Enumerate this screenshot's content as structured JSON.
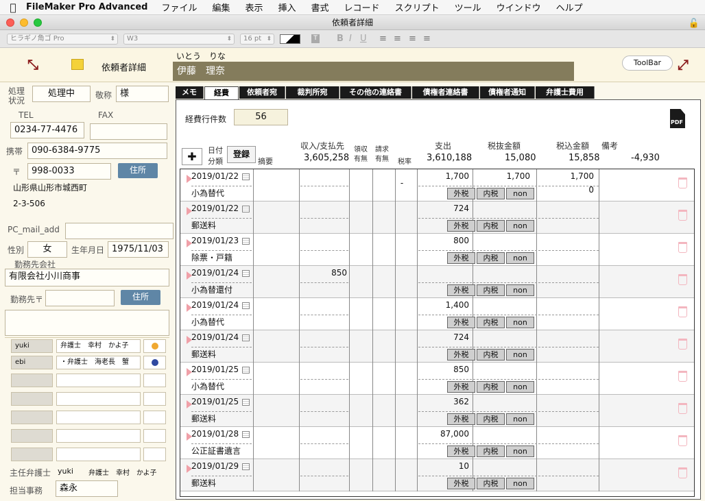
{
  "menubar": {
    "app_name": "FileMaker Pro Advanced",
    "items": [
      "ファイル",
      "編集",
      "表示",
      "挿入",
      "書式",
      "レコード",
      "スクリプト",
      "ツール",
      "ウインドウ",
      "ヘルプ"
    ]
  },
  "window": {
    "title": "依頼者詳細"
  },
  "format_bar": {
    "font": "ヒラギノ角ゴ Pro",
    "weight": "W3",
    "size": "16 pt"
  },
  "header": {
    "layout_title": "依頼者詳細",
    "furigana": "いとう　りな",
    "name": "伊藤　理奈",
    "toolbar_label": "ToolBar"
  },
  "left": {
    "status_label": "処理\n状況",
    "status_value": "処理中",
    "honorific_label": "敬称",
    "honorific_value": "様",
    "tel_label": "TEL",
    "fax_label": "FAX",
    "tel_value": "0234-77-4476",
    "fax_value": "",
    "mobile_label": "携帯",
    "mobile_value": "090-6384-9775",
    "zip_label": "〒",
    "zip_value": "998-0033",
    "address_button": "住所",
    "address1": "山形県山形市城西町",
    "address2": "2-3-506",
    "pcmail_label": "PC_mail_add",
    "gender_label": "性別",
    "gender_value": "女",
    "birth_label": "生年月日",
    "birth_value": "1975/11/03",
    "employer_label": "勤務先会社",
    "employer_value": "有限会社小川商事",
    "employer_zip_label": "勤務先〒",
    "employer_address_button": "住所",
    "lawyers": [
      {
        "code": "yuki",
        "name": "弁護士　幸村　かよ子"
      },
      {
        "code": "ebi",
        "name": "・弁護士　海老長　蟹"
      }
    ],
    "dot_colors": [
      "#f0a830",
      "#2f49a0"
    ],
    "chief_label": "主任弁護士",
    "chief_code": "yuki",
    "chief_name": "弁護士　幸村　かよ子",
    "staff_label": "担当事務",
    "staff_value": "森永"
  },
  "tabs": [
    "メモ",
    "経費",
    "依頼者宛",
    "裁判所宛",
    "その他の連絡書",
    "債権者連絡書",
    "債権者通知",
    "弁護士費用"
  ],
  "expenses": {
    "count_label": "経費行件数",
    "count_value": "56",
    "add_button": "✚",
    "register_button": "登録",
    "col_date": "日付",
    "col_category": "分類",
    "col_summary": "摘要",
    "col_payee": "収入/支払先",
    "col_receipt": "領収\n有無",
    "col_invoice": "請求\n有無",
    "col_taxrate": "税率",
    "col_expense": "支出",
    "col_pretax": "税抜金額",
    "col_taxin": "税込金額",
    "col_notes": "備考",
    "total_income": "3,605,258",
    "total_expense": "3,610,188",
    "total_pretax": "15,080",
    "total_taxin": "15,858",
    "total_notes": "-4,930",
    "tax_buttons": [
      "外税",
      "内税",
      "non"
    ],
    "pdf_label": "PDF",
    "rows": [
      {
        "date": "2019/01/22",
        "memo": "小為替代",
        "income": "",
        "taxrate": "-",
        "expense": "1,700",
        "pretax": "1,700",
        "taxin": "1,700",
        "tax": "0"
      },
      {
        "date": "2019/01/22",
        "memo": "郵送料",
        "income": "",
        "taxrate": "",
        "expense": "724",
        "pretax": "",
        "taxin": "",
        "tax": ""
      },
      {
        "date": "2019/01/23",
        "memo": "除票・戸籍",
        "income": "",
        "taxrate": "",
        "expense": "800",
        "pretax": "",
        "taxin": "",
        "tax": ""
      },
      {
        "date": "2019/01/24",
        "memo": "小為替還付",
        "income": "850",
        "taxrate": "",
        "expense": "",
        "pretax": "",
        "taxin": "",
        "tax": ""
      },
      {
        "date": "2019/01/24",
        "memo": "小為替代",
        "income": "",
        "taxrate": "",
        "expense": "1,400",
        "pretax": "",
        "taxin": "",
        "tax": ""
      },
      {
        "date": "2019/01/24",
        "memo": "郵送料",
        "income": "",
        "taxrate": "",
        "expense": "724",
        "pretax": "",
        "taxin": "",
        "tax": ""
      },
      {
        "date": "2019/01/25",
        "memo": "小為替代",
        "income": "",
        "taxrate": "",
        "expense": "850",
        "pretax": "",
        "taxin": "",
        "tax": ""
      },
      {
        "date": "2019/01/25",
        "memo": "郵送料",
        "income": "",
        "taxrate": "",
        "expense": "362",
        "pretax": "",
        "taxin": "",
        "tax": ""
      },
      {
        "date": "2019/01/28",
        "memo": "公正証書遺言",
        "income": "",
        "taxrate": "",
        "expense": "87,000",
        "pretax": "",
        "taxin": "",
        "tax": ""
      },
      {
        "date": "2019/01/29",
        "memo": "郵送料",
        "income": "",
        "taxrate": "",
        "expense": "10",
        "pretax": "",
        "taxin": "",
        "tax": ""
      }
    ]
  }
}
